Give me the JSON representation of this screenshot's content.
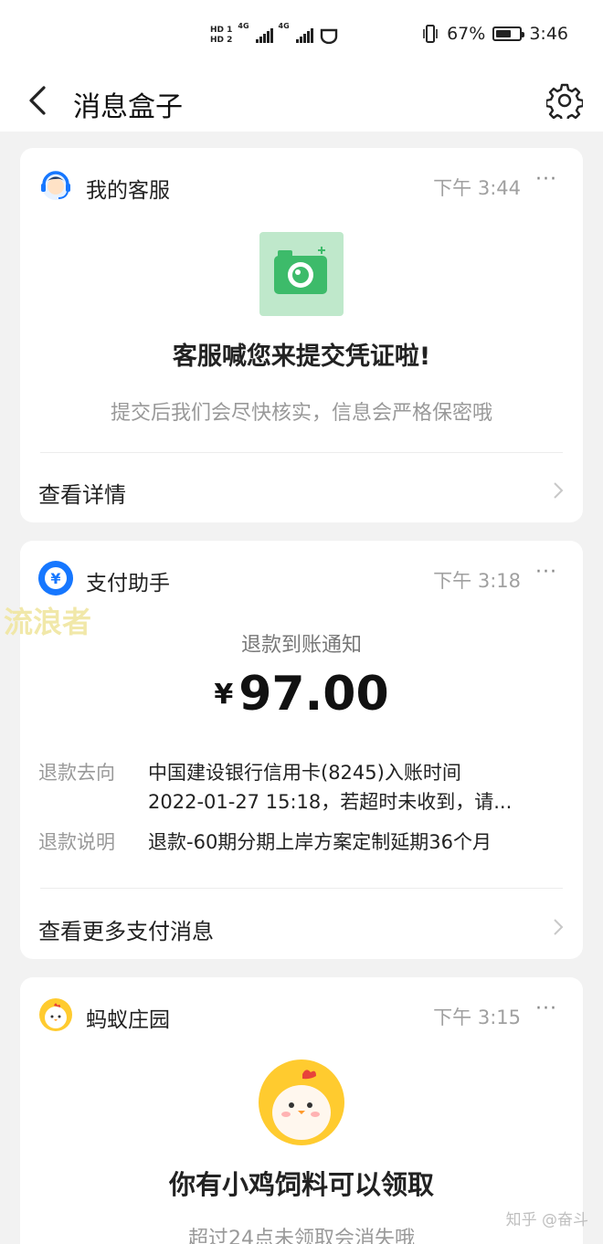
{
  "status_bar": {
    "hd1": "HD 1",
    "hd2": "HD 2",
    "net1": "4G",
    "net2": "4G",
    "battery_percent": "67%",
    "battery_level": 0.67,
    "time": "3:46"
  },
  "nav": {
    "title": "消息盒子"
  },
  "cards": {
    "service": {
      "app_name": "我的客服",
      "time": "下午 3:44",
      "more": "···",
      "headline": "客服喊您来提交凭证啦!",
      "subtext": "提交后我们会尽快核实，信息会严格保密哦",
      "footer": "查看详情"
    },
    "payment": {
      "app_name": "支付助手",
      "icon_glyph": "¥",
      "time": "下午 3:18",
      "more": "···",
      "notice_title": "退款到账通知",
      "currency": "¥",
      "amount": "97.00",
      "rows": [
        {
          "label": "退款去向",
          "value_line1": "中国建设银行信用卡(8245)入账时间",
          "value_line2": "2022-01-27 15:18，若超时未收到，请..."
        },
        {
          "label": "退款说明",
          "value_line1": "退款-60期分期上岸方案定制延期36个月"
        }
      ],
      "footer": "查看更多支付消息"
    },
    "farm": {
      "app_name": "蚂蚁庄园",
      "time": "下午 3:15",
      "more": "···",
      "headline": "你有小鸡饲料可以领取",
      "subtext": "超过24点未领取会消失哦"
    }
  },
  "watermark": "流浪者",
  "zhihu_mark": "知乎 @奋斗",
  "colors": {
    "accent_blue": "#1677ff",
    "camera_green": "#3dbb6a",
    "chick_yellow": "#ffcb2f"
  }
}
